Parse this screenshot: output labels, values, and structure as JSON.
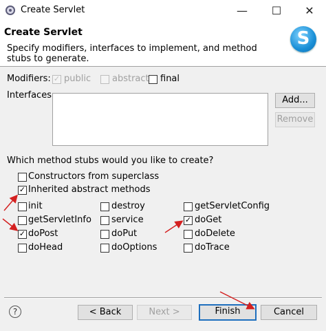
{
  "window": {
    "title": "Create Servlet",
    "minimize_glyph": "—",
    "maximize_glyph": "☐",
    "close_glyph": "✕"
  },
  "header": {
    "title": "Create Servlet",
    "description": "Specify modifiers, interfaces to implement, and method stubs to generate.",
    "logo_letter": "S"
  },
  "modifiers": {
    "label": "Modifiers:",
    "options": [
      {
        "label": "public",
        "checked": true,
        "enabled": false
      },
      {
        "label": "abstract",
        "checked": false,
        "enabled": false
      },
      {
        "label": "final",
        "checked": false,
        "enabled": true
      }
    ]
  },
  "interfaces": {
    "label": "Interfaces:",
    "add_button": "Add...",
    "remove_button": "Remove"
  },
  "stubs": {
    "question": "Which method stubs would you like to create?",
    "constructors": {
      "label": "Constructors from superclass",
      "checked": false
    },
    "inherited": {
      "label": "Inherited abstract methods",
      "checked": true
    },
    "methods": [
      {
        "label": "init",
        "checked": false
      },
      {
        "label": "destroy",
        "checked": false
      },
      {
        "label": "getServletConfig",
        "checked": false
      },
      {
        "label": "getServletInfo",
        "checked": false
      },
      {
        "label": "service",
        "checked": false
      },
      {
        "label": "doGet",
        "checked": true
      },
      {
        "label": "doPost",
        "checked": true
      },
      {
        "label": "doPut",
        "checked": false
      },
      {
        "label": "doDelete",
        "checked": false
      },
      {
        "label": "doHead",
        "checked": false
      },
      {
        "label": "doOptions",
        "checked": false
      },
      {
        "label": "doTrace",
        "checked": false
      }
    ]
  },
  "footer": {
    "help_glyph": "?",
    "back_button": "< Back",
    "next_button": "Next >",
    "finish_button": "Finish",
    "cancel_button": "Cancel"
  },
  "colors": {
    "annotation_arrow": "#d42020",
    "default_button_border": "#1e6fbe"
  },
  "check_glyph": "✓"
}
